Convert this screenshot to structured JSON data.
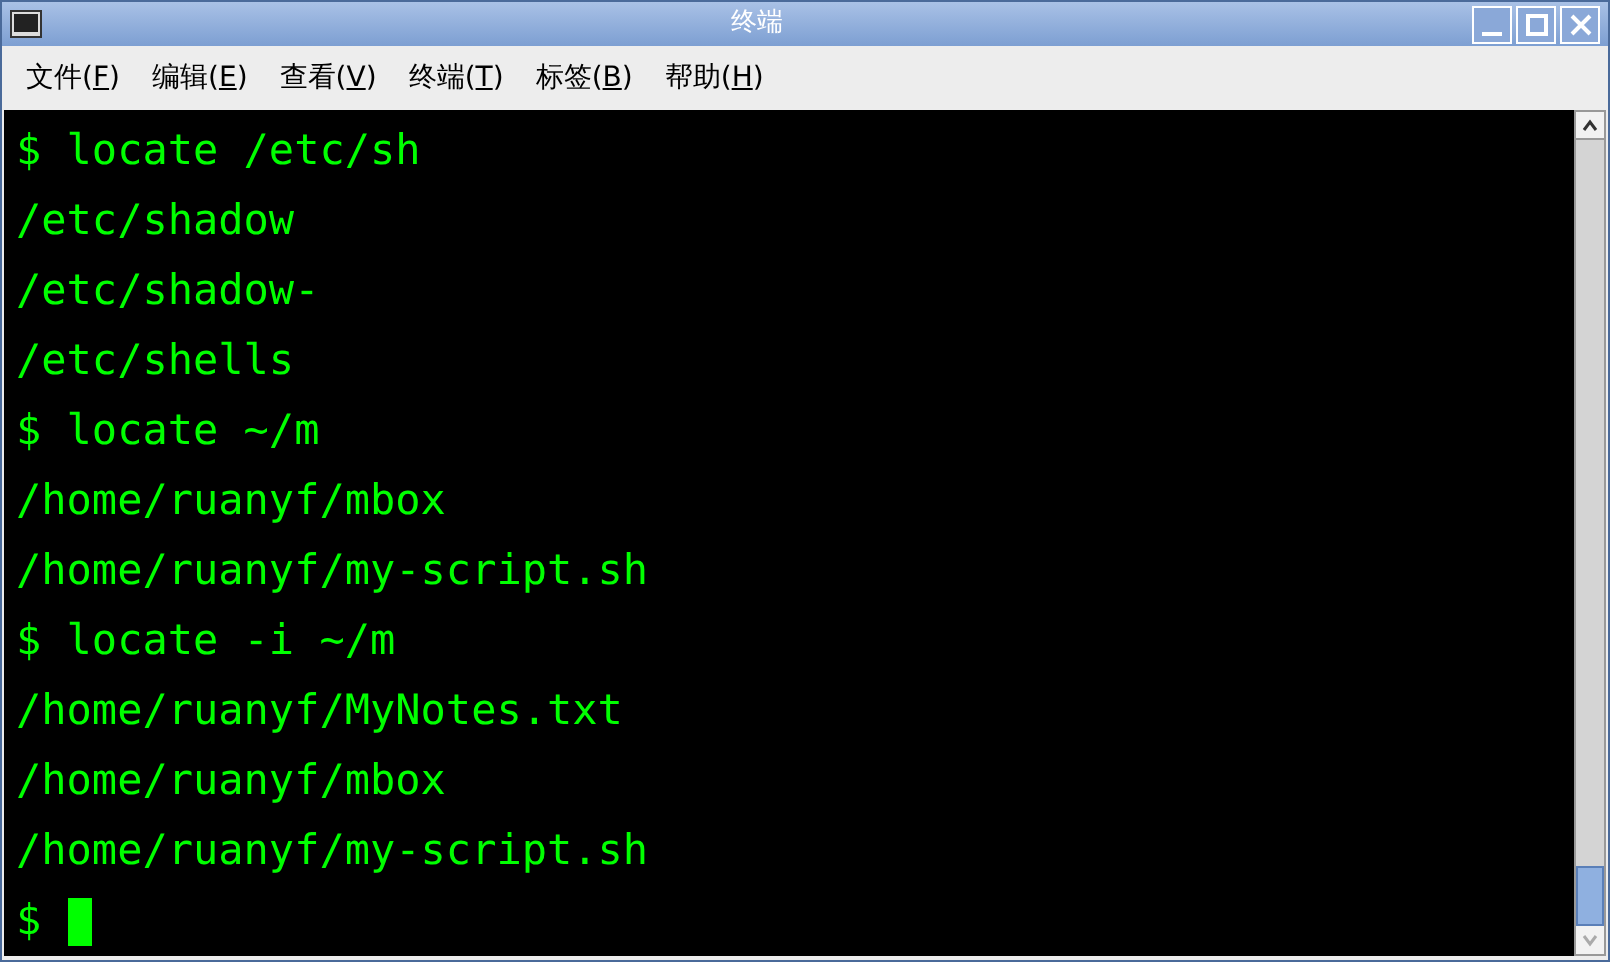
{
  "window": {
    "title": "终端"
  },
  "menu": [
    {
      "text_before": "文件(",
      "mnemonic": "F",
      "text_after": ")"
    },
    {
      "text_before": "编辑(",
      "mnemonic": "E",
      "text_after": ")"
    },
    {
      "text_before": "查看(",
      "mnemonic": "V",
      "text_after": ")"
    },
    {
      "text_before": "终端(",
      "mnemonic": "T",
      "text_after": ")"
    },
    {
      "text_before": "标签(",
      "mnemonic": "B",
      "text_after": ")"
    },
    {
      "text_before": "帮助(",
      "mnemonic": "H",
      "text_after": ")"
    }
  ],
  "terminal": {
    "lines": [
      "$ locate /etc/sh",
      "/etc/shadow",
      "/etc/shadow-",
      "/etc/shells",
      "$ locate ~/m",
      "/home/ruanyf/mbox",
      "/home/ruanyf/my-script.sh",
      "$ locate -i ~/m",
      "/home/ruanyf/MyNotes.txt",
      "/home/ruanyf/mbox",
      "/home/ruanyf/my-script.sh"
    ],
    "prompt": "$",
    "cursor": true
  }
}
